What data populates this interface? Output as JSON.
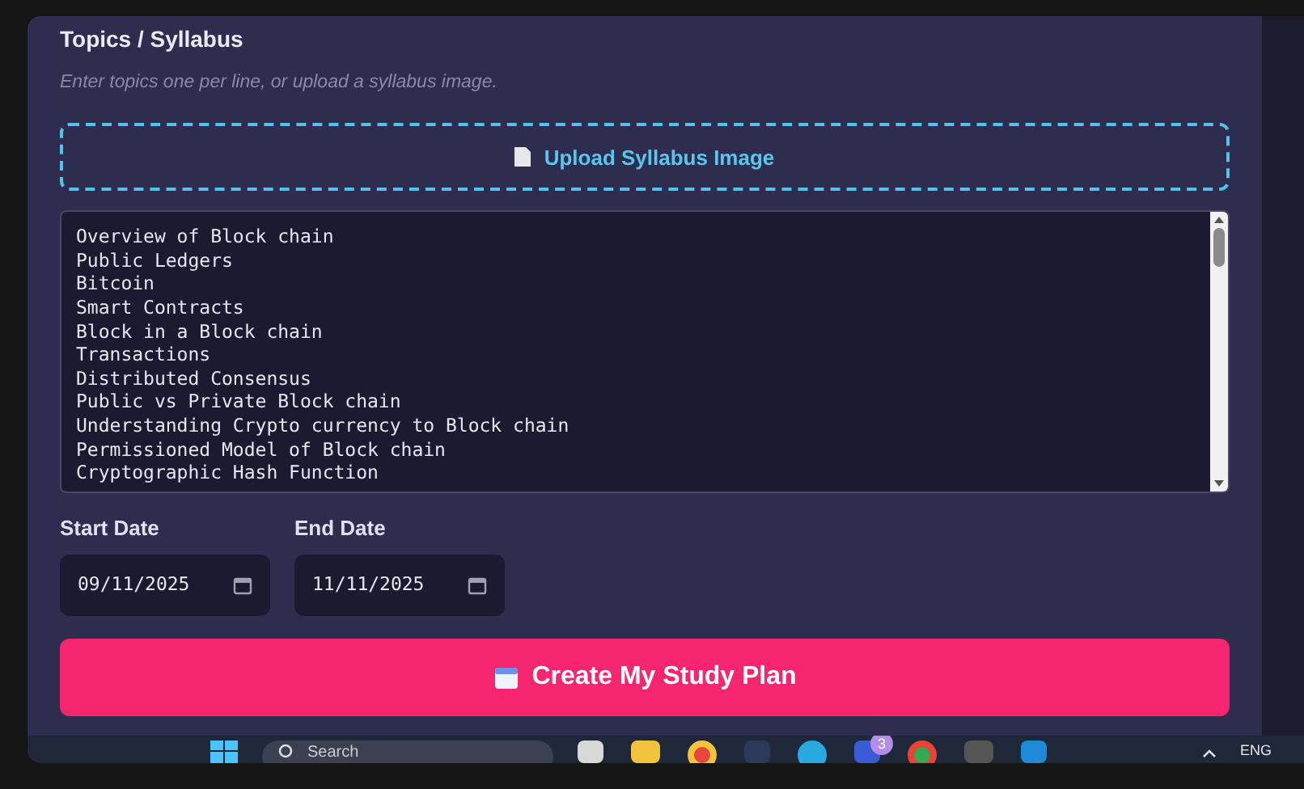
{
  "section": {
    "title": "Topics / Syllabus",
    "hint": "Enter topics one per line, or upload a syllabus image."
  },
  "upload_button": {
    "label": "Upload Syllabus Image"
  },
  "topics": [
    "Overview of Block chain",
    "Public Ledgers",
    "Bitcoin",
    "Smart Contracts",
    "Block in a Block chain",
    "Transactions",
    "Distributed Consensus",
    "Public vs Private Block chain",
    "Understanding Crypto currency to Block chain",
    "Permissioned Model of Block chain",
    "Cryptographic Hash Function"
  ],
  "dates": [
    {
      "label": "Start Date",
      "value": "09/11/2025"
    },
    {
      "label": "End Date",
      "value": "11/11/2025"
    }
  ],
  "submit_button": {
    "label": "Create My Study Plan"
  },
  "taskbar": {
    "search_placeholder": "Search",
    "badge": "3",
    "language": "ENG"
  }
}
